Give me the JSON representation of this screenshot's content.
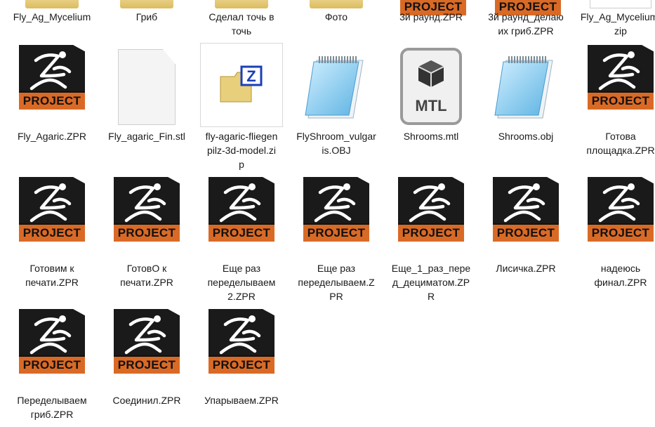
{
  "top_row_labels": [
    {
      "name": "Fly_Ag_Mycelium",
      "lines": [
        "Fly_Ag_Mycelium"
      ]
    },
    {
      "name": "Гриб",
      "lines": [
        "Гриб"
      ]
    },
    {
      "name": "Сделал точь в точь",
      "lines": [
        "Сделал точь в",
        "точь"
      ]
    },
    {
      "name": "Фото",
      "lines": [
        "Фото"
      ]
    },
    {
      "name": "3й раунд.ZPR",
      "lines": [
        "3й раунд.ZPR"
      ]
    },
    {
      "name": "3й раунд_делаю их гриб.ZPR",
      "lines": [
        "3й раунд_делаю",
        "их гриб.ZPR"
      ]
    },
    {
      "name": "Fly_Ag_Mycelium.zip",
      "lines": [
        "Fly_Ag_Mycelium.",
        "zip"
      ]
    }
  ],
  "files": [
    {
      "type": "zpr",
      "lines": [
        "Fly_Agaric.ZPR"
      ]
    },
    {
      "type": "blank",
      "lines": [
        "Fly_agaric_Fin.stl"
      ]
    },
    {
      "type": "zip",
      "lines": [
        "fly-agaric-fliegen",
        "pilz-3d-model.zi",
        "p"
      ]
    },
    {
      "type": "notepad",
      "lines": [
        "FlyShroom_vulgar",
        "is.OBJ"
      ]
    },
    {
      "type": "mtl",
      "lines": [
        "Shrooms.mtl"
      ]
    },
    {
      "type": "notepad",
      "lines": [
        "Shrooms.obj"
      ]
    },
    {
      "type": "zpr",
      "lines": [
        "Готова",
        "площадка.ZPR"
      ]
    },
    {
      "type": "zpr",
      "lines": [
        "Готовим к",
        "печати.ZPR"
      ]
    },
    {
      "type": "zpr",
      "lines": [
        "ГотовО к",
        "печати.ZPR"
      ]
    },
    {
      "type": "zpr",
      "lines": [
        "Еще раз",
        "переделываем",
        "2.ZPR"
      ]
    },
    {
      "type": "zpr",
      "lines": [
        "Еще раз",
        "переделываем.Z",
        "PR"
      ]
    },
    {
      "type": "zpr",
      "lines": [
        "Еще_1_раз_пере",
        "д_дециматом.ZP",
        "R"
      ]
    },
    {
      "type": "zpr",
      "lines": [
        "Лисичка.ZPR"
      ]
    },
    {
      "type": "zpr",
      "lines": [
        "надеюсь",
        "финал.ZPR"
      ]
    },
    {
      "type": "zpr",
      "lines": [
        "Переделываем",
        "гриб.ZPR"
      ]
    },
    {
      "type": "zpr",
      "lines": [
        "Соединил.ZPR"
      ]
    },
    {
      "type": "zpr",
      "lines": [
        "Упарываем.ZPR"
      ]
    }
  ],
  "zpr_badge_text": "PROJECT",
  "mtl_badge_text": "MTL",
  "zip_badge_letter": "Z",
  "colors": {
    "zpr_dark": "#1a1a1a",
    "zpr_orange": "#d96a26",
    "label_text": "#1a1a1a"
  }
}
